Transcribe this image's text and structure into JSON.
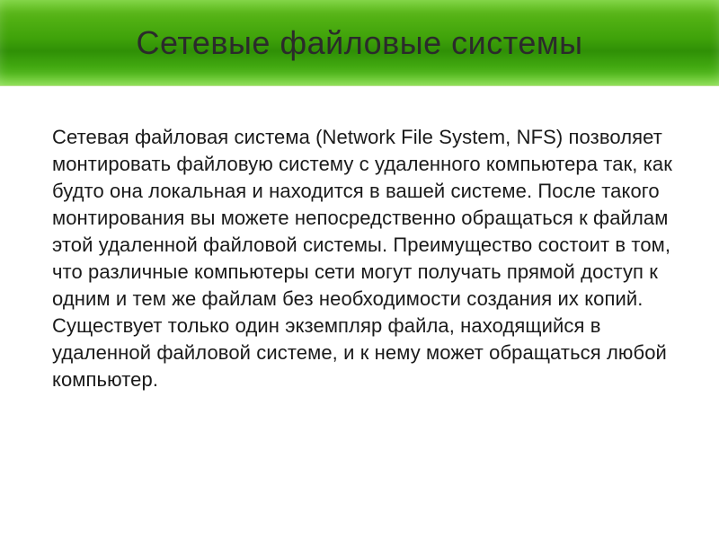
{
  "slide": {
    "title": "Сетевые файловые системы",
    "bullet_marker": "",
    "body": "Сетевая файловая система (Network File System, NFS) позволяет монтировать файловую систему с удаленного компьютера так, как будто она локальная и находится в вашей системе. После такого монтирования вы можете непосредственно обращаться к файлам этой удаленной файловой системы. Преимущество состоит в том, что различные компьютеры сети могут получать прямой доступ к одним и тем же файлам без необходимости создания их копий. Существует только один экземпляр файла, находящийся в удаленной файловой системе, и к нему может обращаться любой компьютер."
  }
}
